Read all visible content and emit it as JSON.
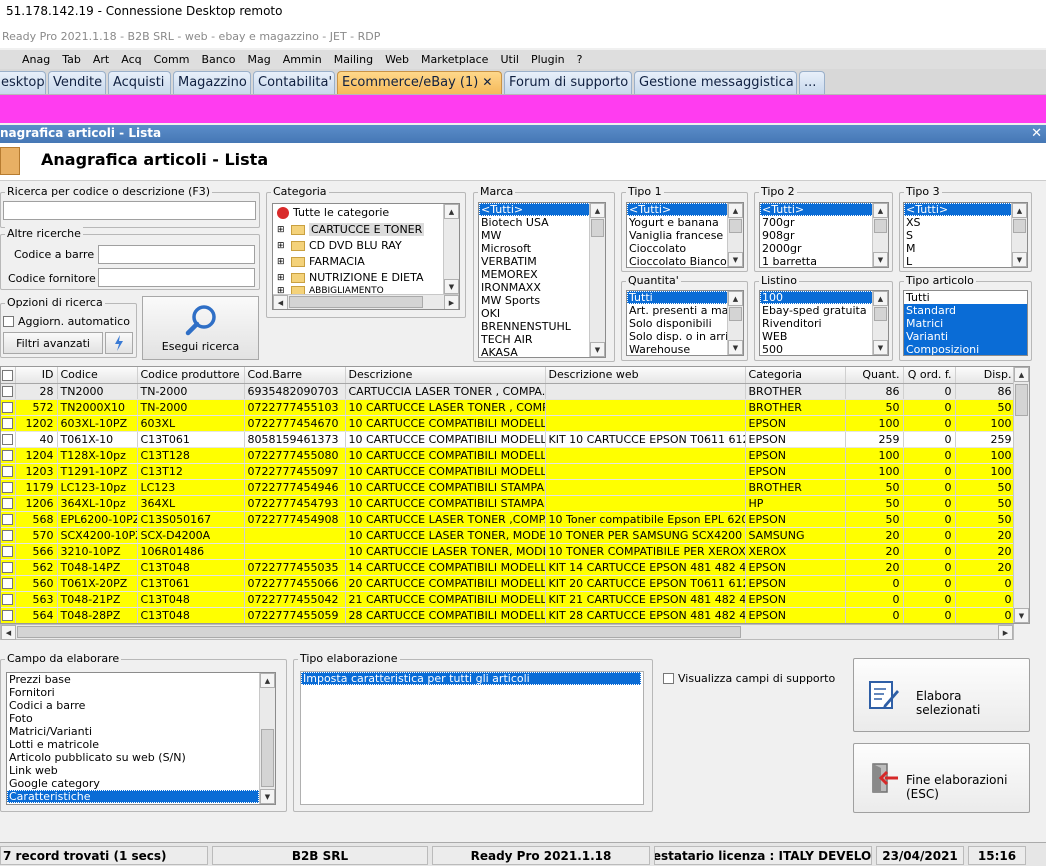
{
  "window": {
    "rdp_title": "51.178.142.19 - Connessione Desktop remoto",
    "app_title": "Ready Pro 2021.1.18 - B2B SRL - web - ebay e magazzino - JET - RDP"
  },
  "menu": [
    "Anag",
    "Tab",
    "Art",
    "Acq",
    "Comm",
    "Banco",
    "Mag",
    "Ammin",
    "Mailing",
    "Web",
    "Marketplace",
    "Util",
    "Plugin",
    "?"
  ],
  "tabs": {
    "desktop": "esktop",
    "vendite": "Vendite",
    "acquisti": "Acquisti",
    "magazzino": "Magazzino",
    "contabilita": "Contabilita'",
    "ecommerce": "Ecommerce/eBay (1)",
    "ecommerce_close": "✕",
    "forum": "Forum di supporto",
    "messaggistica": "Gestione messaggistica",
    "more": "..."
  },
  "form": {
    "window_title": "nagrafica articoli  - Lista",
    "close": "✕",
    "heading": "Anagrafica articoli  - Lista"
  },
  "search": {
    "legend": "Ricerca per codice o descrizione (F3)",
    "value": "",
    "altre_legend": "Altre ricerche",
    "barcode_label": "Codice a barre :",
    "barcode_value": "",
    "supplier_label": "Codice fornitore :",
    "supplier_value": "",
    "options_legend": "Opzioni di ricerca",
    "auto_update_label": "Aggiorn. automatico",
    "advanced_filters": "Filtri avanzati",
    "execute_label": "Esegui ricerca"
  },
  "categoria": {
    "legend": "Categoria",
    "root": "Tutte le categorie",
    "items": [
      "CARTUCCE E TONER",
      "CD DVD BLU RAY",
      "FARMACIA",
      "NUTRIZIONE E DIETA",
      "ABBIGLIAMENTO"
    ]
  },
  "marca": {
    "legend": "Marca",
    "items": [
      "<Tutti>",
      "Biotech USA",
      "MW",
      "Microsoft",
      "VERBATIM",
      "MEMOREX",
      "IRONMAXX",
      "MW Sports",
      "OKI",
      "BRENNENSTUHL",
      "TECH AIR",
      "AKASA"
    ]
  },
  "tipo1": {
    "legend": "Tipo 1",
    "items": [
      "<Tutti>",
      "Yogurt e banana",
      "Vaniglia francese",
      "Cioccolato",
      "Cioccolato Bianco"
    ]
  },
  "tipo2": {
    "legend": "Tipo 2",
    "items": [
      "<Tutti>",
      "700gr",
      "908gr",
      "2000gr",
      "1 barretta"
    ]
  },
  "tipo3": {
    "legend": "Tipo 3",
    "items": [
      "<Tutti>",
      "XS",
      "S",
      "M",
      "L"
    ]
  },
  "quantita": {
    "legend": "Quantita'",
    "items": [
      "Tutti",
      "Art. presenti a magazzino",
      "Solo disponibili",
      "Solo disp. o in arrivo",
      "Warehouse"
    ]
  },
  "listino": {
    "legend": "Listino",
    "items": [
      "100",
      "Ebay-sped gratuita",
      "Rivenditori",
      "WEB",
      "500"
    ]
  },
  "tipo_articolo": {
    "legend": "Tipo articolo",
    "items": [
      "Tutti",
      "Standard",
      "Matrici",
      "Varianti",
      "Composizioni"
    ]
  },
  "grid": {
    "columns": [
      "ID",
      "Codice",
      "Codice produttore",
      "Cod.Barre",
      "Descrizione",
      "Descrizione web",
      "Categoria",
      "Quant.",
      "Q ord. f.",
      "Disp."
    ],
    "rows": [
      {
        "style": "gray",
        "id": "28",
        "codice": "TN2000",
        "produttore": "TN-2000",
        "barre": "6935482090703",
        "descrizione": " CARTUCCIA LASER TONER , COMPA...",
        "web": "",
        "categoria": "BROTHER",
        "quant": "86",
        "qord": "0",
        "disp": "86"
      },
      {
        "style": "yellow",
        "id": "572",
        "codice": "TN2000X10",
        "produttore": "TN-2000",
        "barre": "0722777455103",
        "descrizione": "10 CARTUCCE  LASER TONER , COMP...",
        "web": "",
        "categoria": "BROTHER",
        "quant": "50",
        "qord": "0",
        "disp": "50"
      },
      {
        "style": "yellow",
        "id": "1202",
        "codice": "603XL-10PZ",
        "produttore": "603XL",
        "barre": "0722777454670",
        "descrizione": "10 CARTUCCE COMPATIBILI MODELL...",
        "web": "",
        "categoria": "EPSON",
        "quant": "100",
        "qord": "0",
        "disp": "100"
      },
      {
        "style": "white",
        "id": "40",
        "codice": "T061X-10",
        "produttore": "C13T061",
        "barre": "8058159461373",
        "descrizione": "10 CARTUCCE COMPATIBILI MODELL...",
        "web": "KIT 10 CARTUCCE EPSON T0611 612 ...",
        "categoria": "EPSON",
        "quant": "259",
        "qord": "0",
        "disp": "259"
      },
      {
        "style": "yellow",
        "id": "1204",
        "codice": "T128X-10pz",
        "produttore": "C13T128",
        "barre": "0722777455080",
        "descrizione": "10 CARTUCCE COMPATIBILI MODELL...",
        "web": "",
        "categoria": "EPSON",
        "quant": "100",
        "qord": "0",
        "disp": "100"
      },
      {
        "style": "yellow",
        "id": "1203",
        "codice": "T1291-10PZ",
        "produttore": "C13T12",
        "barre": "0722777455097",
        "descrizione": "10 CARTUCCE COMPATIBILI MODELL...",
        "web": "",
        "categoria": "EPSON",
        "quant": "100",
        "qord": "0",
        "disp": "100"
      },
      {
        "style": "yellow",
        "id": "1179",
        "codice": "LC123-10pz",
        "produttore": "LC123",
        "barre": "0722777454946",
        "descrizione": "10 CARTUCCE COMPATIBILI STAMPA...",
        "web": "",
        "categoria": "BROTHER",
        "quant": "50",
        "qord": "0",
        "disp": "50"
      },
      {
        "style": "yellow",
        "id": "1206",
        "codice": "364XL-10pz",
        "produttore": "364XL",
        "barre": "0722777454793",
        "descrizione": "10 CARTUCCE COMPATIBILI STAMPA...",
        "web": "",
        "categoria": "HP",
        "quant": "50",
        "qord": "0",
        "disp": "50"
      },
      {
        "style": "yellow",
        "id": "568",
        "codice": "EPL6200-10PZ",
        "produttore": "C13S050167",
        "barre": "0722777454908",
        "descrizione": "10 CARTUCCE LASER TONER ,COMP...",
        "web": "10 Toner compatibile Epson EPL 6200 S...",
        "categoria": "EPSON",
        "quant": "50",
        "qord": "0",
        "disp": "50"
      },
      {
        "style": "yellow",
        "id": "570",
        "codice": "SCX4200-10PZ",
        "produttore": "SCX-D4200A",
        "barre": "",
        "descrizione": "10 CARTUCCE LASER TONER, MODEL...",
        "web": "10 TONER PER SAMSUNG SCX4200 S...",
        "categoria": "SAMSUNG",
        "quant": "20",
        "qord": "0",
        "disp": "20"
      },
      {
        "style": "yellow",
        "id": "566",
        "codice": "3210-10PZ",
        "produttore": "106R01486",
        "barre": "",
        "descrizione": "10 CARTUCCIE LASER TONER, MODE...",
        "web": "10 TONER COMPATIBILE PER XEROX ...",
        "categoria": "XEROX",
        "quant": "20",
        "qord": "0",
        "disp": "20"
      },
      {
        "style": "yellow",
        "id": "562",
        "codice": "T048-14PZ",
        "produttore": "C13T048",
        "barre": "0722777455035",
        "descrizione": "14 CARTUCCE COMPATIBILI MODELL...",
        "web": "KIT 14 CARTUCCE EPSON 481 482 48...",
        "categoria": "EPSON",
        "quant": "20",
        "qord": "0",
        "disp": "20"
      },
      {
        "style": "yellow",
        "id": "560",
        "codice": "T061X-20PZ",
        "produttore": "C13T061",
        "barre": "0722777455066",
        "descrizione": "20 CARTUCCE COMPATIBILI MODELL...",
        "web": "KIT 20 CARTUCCE EPSON T0611 612 ...",
        "categoria": "EPSON",
        "quant": "0",
        "qord": "0",
        "disp": "0"
      },
      {
        "style": "yellow",
        "id": "563",
        "codice": "T048-21PZ",
        "produttore": "C13T048",
        "barre": "0722777455042",
        "descrizione": "21 CARTUCCE COMPATIBILI MODELL...",
        "web": "KIT 21 CARTUCCE EPSON 481 482 48...",
        "categoria": "EPSON",
        "quant": "0",
        "qord": "0",
        "disp": "0"
      },
      {
        "style": "yellow",
        "id": "564",
        "codice": "T048-28PZ",
        "produttore": "C13T048",
        "barre": "0722777455059",
        "descrizione": "28 CARTUCCE COMPATIBILI MODELL...",
        "web": "KIT 28 CARTUCCE EPSON 481 482 48...",
        "categoria": "EPSON",
        "quant": "0",
        "qord": "0",
        "disp": "0"
      }
    ]
  },
  "campo": {
    "legend": "Campo da elaborare",
    "items": [
      "Prezzi base",
      "Fornitori",
      "Codici a barre",
      "Foto",
      "Matrici/Varianti",
      "Lotti e matricole",
      "Articolo pubblicato su web (S/N)",
      "Link web",
      "Google category",
      "Caratteristiche"
    ]
  },
  "tipo_elab": {
    "legend": "Tipo elaborazione",
    "items": [
      "Imposta caratteristica per tutti gli articoli"
    ]
  },
  "support_fields_label": "Visualizza campi di supporto",
  "process_selected": "Elabora selezionati",
  "end_processing": "Fine elaborazioni (ESC)",
  "status": {
    "records": "7 record trovati (1 secs)",
    "company": "B2B SRL",
    "version": "Ready Pro 2021.1.18",
    "license": "Intestatario licenza : ITALY DEVELOPM",
    "date": "23/04/2021",
    "time": "15:16"
  }
}
